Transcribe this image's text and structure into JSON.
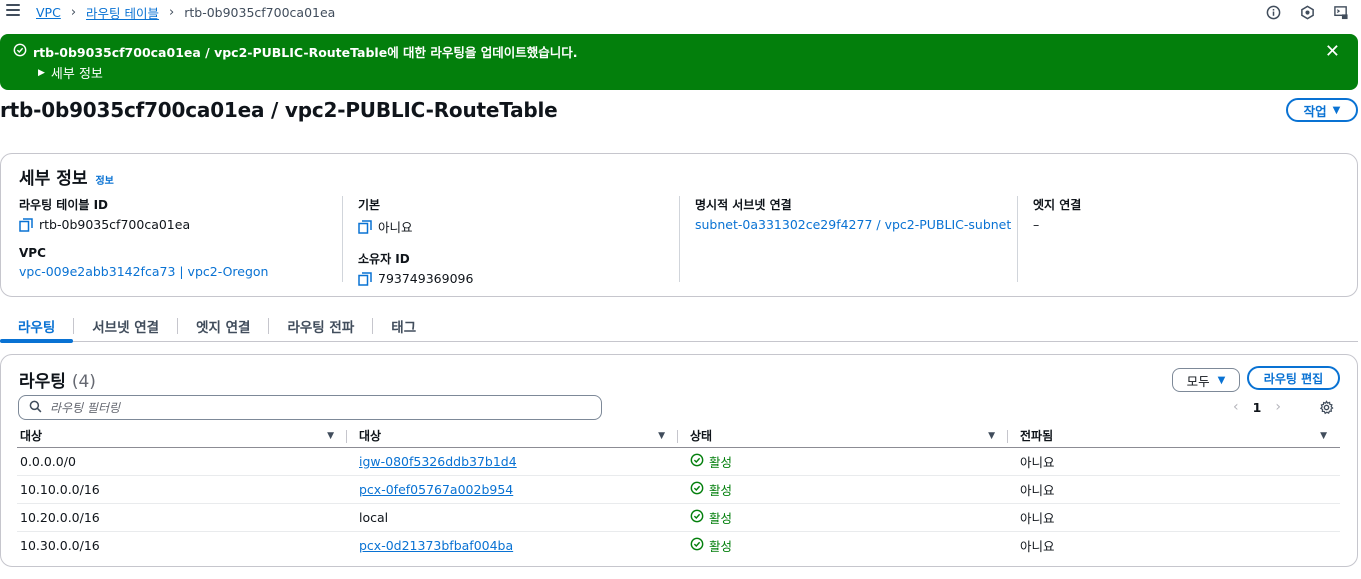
{
  "breadcrumb": {
    "items": [
      "VPC",
      "라우팅 테이블"
    ],
    "current": "rtb-0b9035cf700ca01ea"
  },
  "top_icons": [
    "info-icon",
    "notifications-icon",
    "cloudshell-icon"
  ],
  "flash": {
    "message": "rtb-0b9035cf700ca01ea / vpc2-PUBLIC-RouteTable에 대한 라우팅을 업데이트했습니다.",
    "details_label": "세부 정보",
    "color": "#037f0c"
  },
  "page": {
    "title": "rtb-0b9035cf700ca01ea / vpc2-PUBLIC-RouteTable",
    "actions_label": "작업"
  },
  "details": {
    "title": "세부 정보",
    "info_label": "정보",
    "route_table_id_label": "라우팅 테이블 ID",
    "route_table_id": "rtb-0b9035cf700ca01ea",
    "vpc_label": "VPC",
    "vpc": "vpc-009e2abb3142fca73 | vpc2-Oregon",
    "main_label": "기본",
    "main": "아니요",
    "owner_label": "소유자 ID",
    "owner": "793749369096",
    "subnet_assoc_label": "명시적 서브넷 연결",
    "subnet_assoc": "subnet-0a331302ce29f4277 / vpc2-PUBLIC-subnet",
    "edge_assoc_label": "엣지 연결",
    "edge_assoc": "–"
  },
  "tabs": [
    "라우팅",
    "서브넷 연결",
    "엣지 연결",
    "라우팅 전파",
    "태그"
  ],
  "routes": {
    "title": "라우팅",
    "count": "(4)",
    "filter_label": "모두",
    "edit_label": "라우팅 편집",
    "search_placeholder": "라우팅 필터링",
    "page": "1",
    "columns": [
      "대상",
      "대상",
      "상태",
      "전파됨"
    ],
    "rows": [
      {
        "destination": "0.0.0.0/0",
        "target": "igw-080f5326ddb37b1d4",
        "target_is_link": true,
        "status": "활성",
        "propagated": "아니요"
      },
      {
        "destination": "10.10.0.0/16",
        "target": "pcx-0fef05767a002b954",
        "target_is_link": true,
        "status": "활성",
        "propagated": "아니요"
      },
      {
        "destination": "10.20.0.0/16",
        "target": "local",
        "target_is_link": false,
        "status": "활성",
        "propagated": "아니요"
      },
      {
        "destination": "10.30.0.0/16",
        "target": "pcx-0d21373bfbaf004ba",
        "target_is_link": true,
        "status": "활성",
        "propagated": "아니요"
      }
    ]
  },
  "colors": {
    "link": "#0972d3",
    "success": "#037f0c",
    "text": "#0f141a"
  }
}
